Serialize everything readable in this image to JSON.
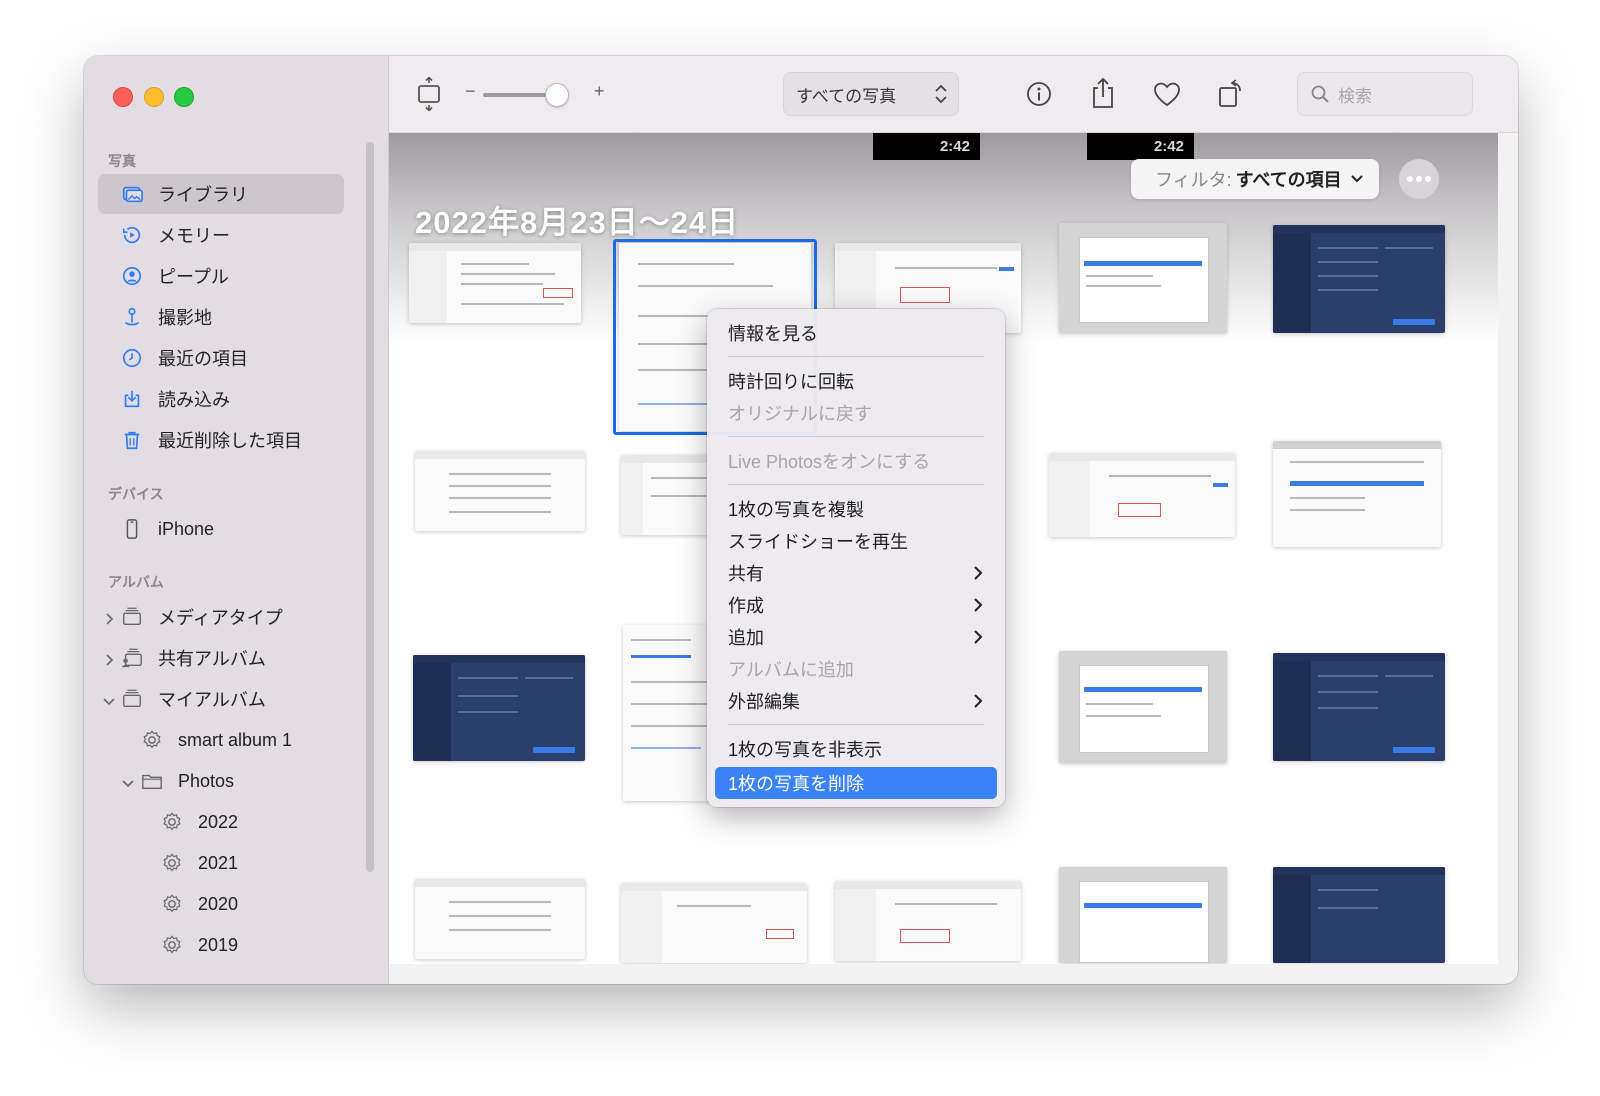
{
  "sidebar": {
    "section_photos": "写真",
    "section_devices": "デバイス",
    "section_albums": "アルバム",
    "items": [
      {
        "label": "ライブラリ",
        "icon": "library-icon"
      },
      {
        "label": "メモリー",
        "icon": "memories-icon"
      },
      {
        "label": "ピープル",
        "icon": "people-icon"
      },
      {
        "label": "撮影地",
        "icon": "places-icon"
      },
      {
        "label": "最近の項目",
        "icon": "recents-icon"
      },
      {
        "label": "読み込み",
        "icon": "imports-icon"
      },
      {
        "label": "最近削除した項目",
        "icon": "trash-icon"
      }
    ],
    "device": {
      "label": "iPhone",
      "icon": "iphone-icon"
    },
    "albums": [
      {
        "label": "メディアタイプ",
        "icon": "folder-stack-icon"
      },
      {
        "label": "共有アルバム",
        "icon": "shared-album-icon"
      },
      {
        "label": "マイアルバム",
        "icon": "folder-stack-icon"
      },
      {
        "label": "smart album 1",
        "icon": "smart-album-icon"
      },
      {
        "label": "Photos",
        "icon": "folder-icon"
      },
      {
        "label": "2022",
        "icon": "smart-album-icon"
      },
      {
        "label": "2021",
        "icon": "smart-album-icon"
      },
      {
        "label": "2020",
        "icon": "smart-album-icon"
      },
      {
        "label": "2019",
        "icon": "smart-album-icon"
      }
    ]
  },
  "toolbar": {
    "zoom_minus": "−",
    "zoom_plus": "+",
    "view_popup": "すべての写真",
    "search_placeholder": "検索"
  },
  "content": {
    "date_heading": "2022年8月23日〜24日",
    "durations": [
      "2:42",
      "2:42"
    ],
    "filter_label": "フィルタ:",
    "filter_value": "すべての項目"
  },
  "context_menu": {
    "items": [
      {
        "label": "情報を見る",
        "enabled": true
      },
      {
        "label": "時計回りに回転",
        "enabled": true
      },
      {
        "label": "オリジナルに戻す",
        "enabled": false
      },
      {
        "label": "Live Photosをオンにする",
        "enabled": false
      },
      {
        "label": "1枚の写真を複製",
        "enabled": true
      },
      {
        "label": "スライドショーを再生",
        "enabled": true
      },
      {
        "label": "共有",
        "enabled": true,
        "submenu": true
      },
      {
        "label": "作成",
        "enabled": true,
        "submenu": true
      },
      {
        "label": "追加",
        "enabled": true,
        "submenu": true
      },
      {
        "label": "アルバムに追加",
        "enabled": false
      },
      {
        "label": "外部編集",
        "enabled": true,
        "submenu": true
      },
      {
        "label": "1枚の写真を非表示",
        "enabled": true
      },
      {
        "label": "1枚の写真を削除",
        "enabled": true,
        "highlighted": true
      }
    ]
  },
  "colors": {
    "accent": "#3a82f7",
    "selection_border": "#1c6ae4",
    "sidebar_bg": "#e3dde3"
  }
}
